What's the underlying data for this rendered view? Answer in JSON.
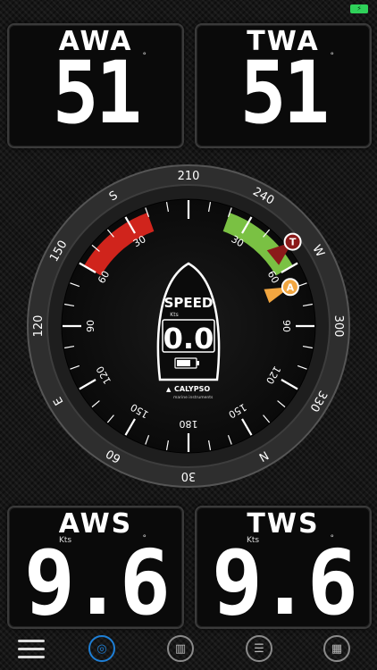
{
  "status": {
    "battery_icon": "battery-charging-icon"
  },
  "panels": {
    "awa": {
      "label": "AWA",
      "value": "51",
      "unit_symbol": "°"
    },
    "twa": {
      "label": "TWA",
      "value": "51",
      "unit_symbol": "°"
    },
    "aws": {
      "label": "AWS",
      "unit": "Kts",
      "value": "9.6",
      "unit_symbol": "°"
    },
    "tws": {
      "label": "TWS",
      "unit": "Kts",
      "value": "9.6",
      "unit_symbol": "°"
    }
  },
  "compass": {
    "outer_labels": [
      "210",
      "240",
      "W",
      "300",
      "330",
      "N",
      "30",
      "60",
      "E",
      "120",
      "150",
      "S"
    ],
    "inner_labels": [
      "30",
      "60",
      "90",
      "120",
      "150",
      "180",
      "150",
      "120",
      "90",
      "60",
      "30"
    ],
    "markers": {
      "true_wind": "T",
      "apparent_wind": "A"
    },
    "colors": {
      "port": "#d0241c",
      "starboard": "#7ac143",
      "true_wind": "#8b1a1a",
      "apparent_wind": "#f2a640"
    }
  },
  "speed": {
    "label": "SPEED",
    "unit": "Kts",
    "value": "0.0",
    "brand": "CALYPSO",
    "brand_sub": "marine instruments",
    "battery_level": 0.75
  },
  "nav": {
    "items": [
      {
        "name": "menu",
        "icon": "hamburger-menu-icon"
      },
      {
        "name": "wind-gauge",
        "icon": "wind-gauge-icon"
      },
      {
        "name": "map",
        "icon": "map-icon"
      },
      {
        "name": "list",
        "icon": "list-icon"
      },
      {
        "name": "grid",
        "icon": "grid-icon"
      }
    ]
  }
}
